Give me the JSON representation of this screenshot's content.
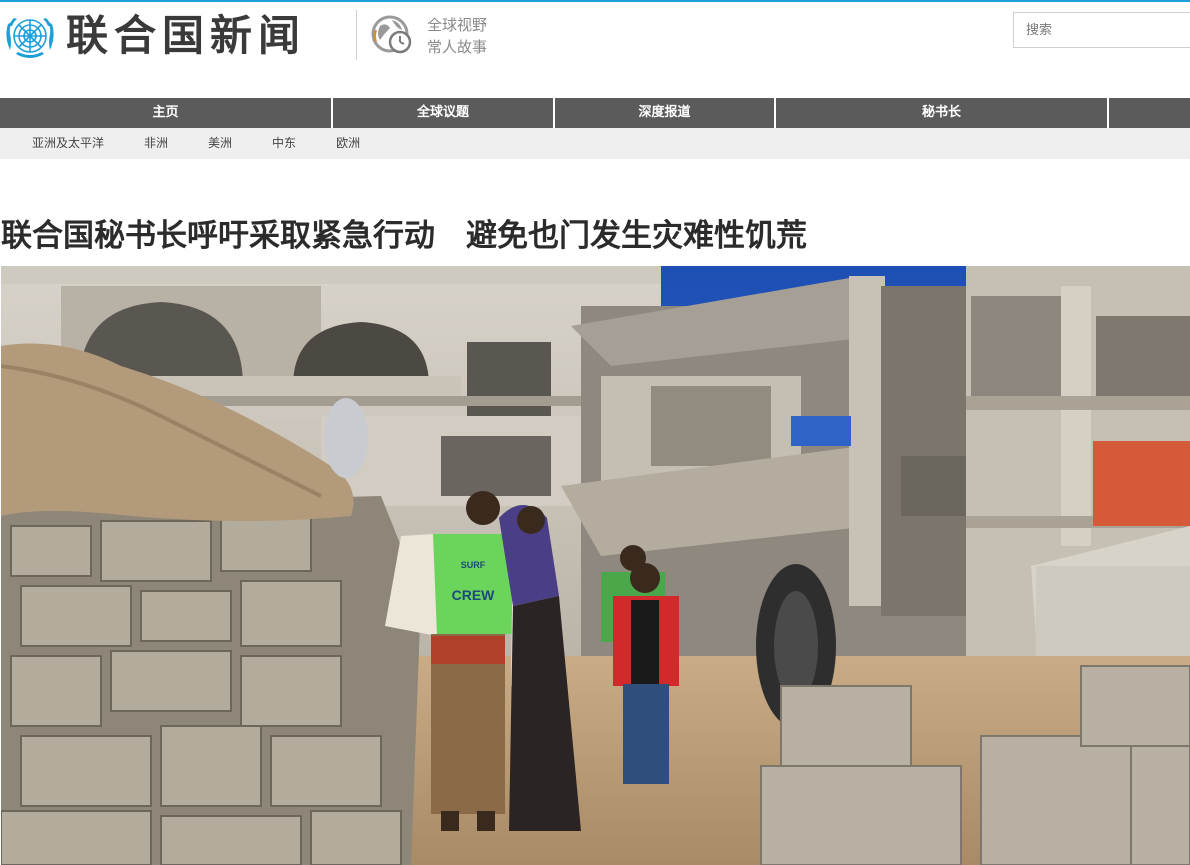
{
  "header": {
    "site_title": "联合国新闻",
    "tagline_line1": "全球视野",
    "tagline_line2": "常人故事",
    "search_placeholder": "搜索",
    "brand_color": "#1d9fd8"
  },
  "main_nav": {
    "items": [
      {
        "label": "主页"
      },
      {
        "label": "全球议题"
      },
      {
        "label": "深度报道"
      },
      {
        "label": "秘书长"
      },
      {
        "label": ""
      }
    ]
  },
  "sub_nav": {
    "items": [
      {
        "label": "亚洲及太平洋"
      },
      {
        "label": "非洲"
      },
      {
        "label": "美洲"
      },
      {
        "label": "中东"
      },
      {
        "label": "欧洲"
      }
    ]
  },
  "article": {
    "title": "联合国秘书长呼吁采取紧急行动　避免也门发生灾难性饥荒",
    "hero_icon": "photo-destroyed-buildings"
  },
  "hero_image": {
    "shirt_text_line1": "SURF",
    "shirt_text_line2": "CREW"
  }
}
